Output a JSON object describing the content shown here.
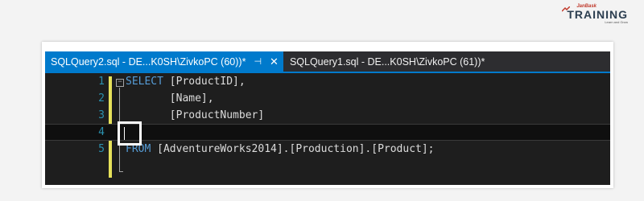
{
  "logo": {
    "small": "JanBask",
    "big": "TRAINING",
    "tagline": "Learn and Grow",
    "brand_color": "#c0392b"
  },
  "tabs": {
    "active": {
      "label": "SQLQuery2.sql - DE...K0SH\\ZivkoPC (60))*",
      "pin_icon": "pin-icon",
      "close_icon": "close-icon"
    },
    "inactive": {
      "label": "SQLQuery1.sql - DE...K0SH\\ZivkoPC (61))*"
    }
  },
  "editor": {
    "line_numbers": [
      "1",
      "2",
      "3",
      "4",
      "5"
    ],
    "lines": [
      {
        "kw": "SELECT",
        "rest": " [ProductID],"
      },
      {
        "kw": "",
        "rest": "       [Name],"
      },
      {
        "kw": "",
        "rest": "       [ProductNumber]"
      },
      {
        "kw": "",
        "rest": ""
      },
      {
        "kw": "FROM",
        "rest": " [AdventureWorks2014].[Production].[Product];"
      }
    ],
    "current_line": 4
  },
  "colors": {
    "accent": "#007acc",
    "editor_bg": "#1e1e1e",
    "keyword": "#569cd6",
    "line_number": "#2b91af",
    "change_bar": "#e6e15a"
  }
}
